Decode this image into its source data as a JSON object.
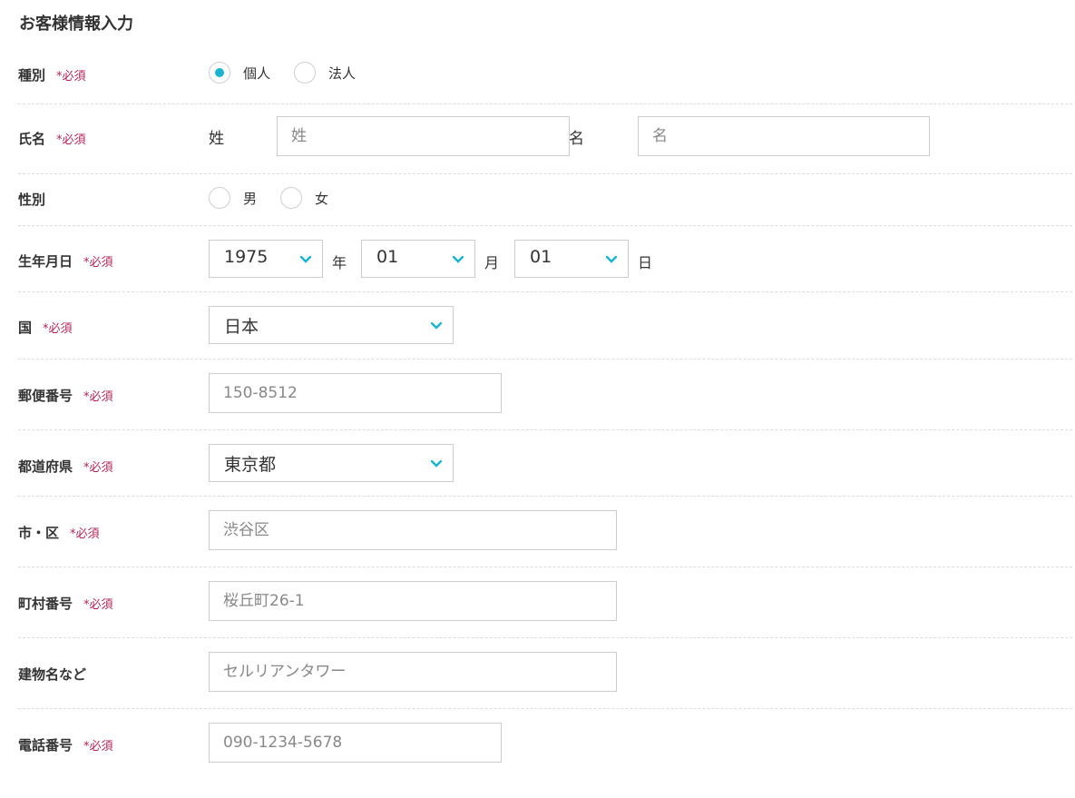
{
  "form": {
    "title": "お客様情報入力",
    "required_mark": "*必須",
    "type": {
      "label": "種別",
      "options": [
        "個人",
        "法人"
      ],
      "selected": 0
    },
    "name": {
      "label": "氏名",
      "last_label": "姓",
      "last_placeholder": "姓",
      "first_label": "名",
      "first_placeholder": "名"
    },
    "gender": {
      "label": "性別",
      "options": [
        "男",
        "女"
      ]
    },
    "birthdate": {
      "label": "生年月日",
      "year": "1975",
      "year_suffix": "年",
      "month": "01",
      "month_suffix": "月",
      "day": "01",
      "day_suffix": "日"
    },
    "country": {
      "label": "国",
      "value": "日本"
    },
    "postal": {
      "label": "郵便番号",
      "placeholder": "150-8512"
    },
    "prefecture": {
      "label": "都道府県",
      "value": "東京都"
    },
    "city": {
      "label": "市・区",
      "placeholder": "渋谷区"
    },
    "address": {
      "label": "町村番号",
      "placeholder": "桜丘町26-1"
    },
    "building": {
      "label": "建物名など",
      "placeholder": "セルリアンタワー"
    },
    "phone": {
      "label": "電話番号",
      "placeholder": "090-1234-5678"
    }
  },
  "colors": {
    "accent": "#1ab4cf",
    "required": "#b0245a",
    "border": "#cccccc",
    "divider": "#dcdcdc"
  },
  "icons": {
    "select_arrow": "chevron-down-icon"
  }
}
